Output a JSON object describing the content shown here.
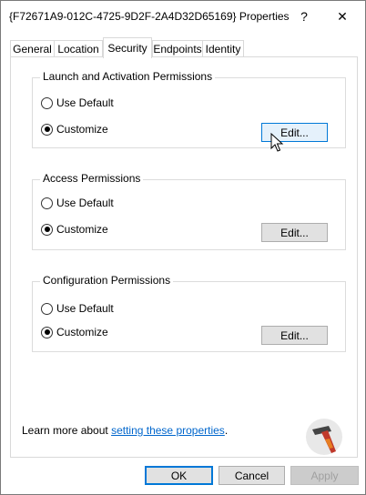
{
  "window": {
    "title": "{F72671A9-012C-4725-9D2F-2A4D32D65169} Properties"
  },
  "titlebar": {
    "help_glyph": "?",
    "close_glyph": "✕"
  },
  "tabs": [
    {
      "label": "General",
      "active": false
    },
    {
      "label": "Location",
      "active": false
    },
    {
      "label": "Security",
      "active": true
    },
    {
      "label": "Endpoints",
      "active": false
    },
    {
      "label": "Identity",
      "active": false
    }
  ],
  "groups": [
    {
      "title": "Launch and Activation Permissions",
      "options": {
        "use_default": "Use Default",
        "customize": "Customize"
      },
      "selected": "customize",
      "edit_label": "Edit..."
    },
    {
      "title": "Access Permissions",
      "options": {
        "use_default": "Use Default",
        "customize": "Customize"
      },
      "selected": "customize",
      "edit_label": "Edit..."
    },
    {
      "title": "Configuration Permissions",
      "options": {
        "use_default": "Use Default",
        "customize": "Customize"
      },
      "selected": "customize",
      "edit_label": "Edit..."
    }
  ],
  "learn_more": {
    "prefix": "Learn more about ",
    "link": "setting these properties",
    "suffix": "."
  },
  "buttons": {
    "ok": "OK",
    "cancel": "Cancel",
    "apply": "Apply"
  },
  "icons": {
    "logo": "hammer-logo-icon",
    "cursor": "mouse-cursor-icon"
  },
  "colors": {
    "accent": "#0078d7",
    "link": "#0066cc",
    "disabled_text": "#a0a0a0"
  }
}
